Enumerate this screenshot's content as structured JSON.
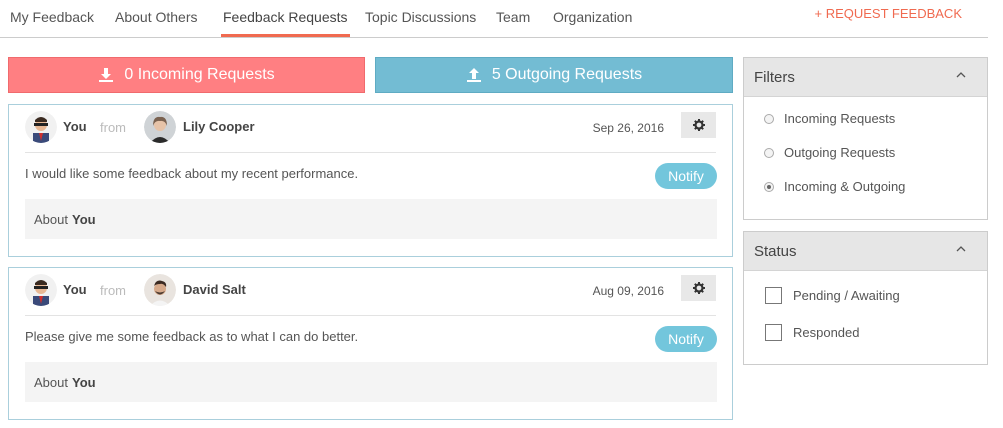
{
  "nav": {
    "tabs": [
      {
        "label": "My Feedback"
      },
      {
        "label": "About Others"
      },
      {
        "label": "Feedback Requests"
      },
      {
        "label": "Topic Discussions"
      },
      {
        "label": "Team"
      },
      {
        "label": "Organization"
      }
    ],
    "active_tab": "Feedback Requests",
    "request_link": "+ REQUEST FEEDBACK"
  },
  "summary": {
    "incoming_label": "0 Incoming Requests",
    "outgoing_label": "5 Outgoing Requests"
  },
  "requests": [
    {
      "requester": "You",
      "from_label": "from",
      "person": "Lily Cooper",
      "date": "Sep 26, 2016",
      "message": "I would like some feedback about my recent performance.",
      "notify_label": "Notify",
      "about_label": "About",
      "about_subject": "You"
    },
    {
      "requester": "You",
      "from_label": "from",
      "person": "David Salt",
      "date": "Aug 09, 2016",
      "message": "Please give me some feedback as to what I can do better.",
      "notify_label": "Notify",
      "about_label": "About",
      "about_subject": "You"
    }
  ],
  "filters": {
    "title": "Filters",
    "options": [
      {
        "label": "Incoming Requests",
        "selected": false
      },
      {
        "label": "Outgoing Requests",
        "selected": false
      },
      {
        "label": "Incoming & Outgoing",
        "selected": true
      }
    ]
  },
  "status": {
    "title": "Status",
    "options": [
      {
        "label": "Pending / Awaiting",
        "checked": false
      },
      {
        "label": "Responded",
        "checked": false
      }
    ]
  },
  "colors": {
    "accent": "#f06a50",
    "incoming": "#ff7f82",
    "outgoing": "#73bcd3",
    "notify": "#73c6dc"
  }
}
